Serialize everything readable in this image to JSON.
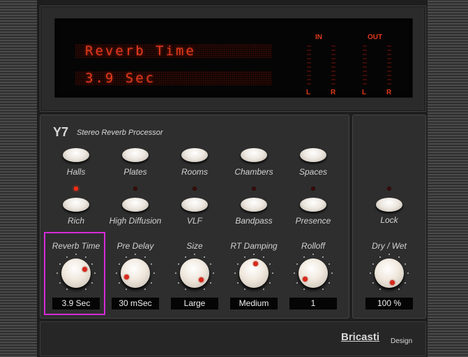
{
  "display": {
    "line1": "Reverb Time",
    "line2": "3.9 Sec",
    "in_label": "IN",
    "out_label": "OUT",
    "channels": [
      "L",
      "R",
      "L",
      "R"
    ]
  },
  "header": {
    "model": "Y7",
    "subtitle": "Stereo Reverb Processor"
  },
  "algorithms": [
    {
      "label": "Halls",
      "led": true
    },
    {
      "label": "Plates",
      "led": false
    },
    {
      "label": "Rooms",
      "led": false
    },
    {
      "label": "Chambers",
      "led": false
    },
    {
      "label": "Spaces",
      "led": false
    }
  ],
  "modifiers": [
    {
      "label": "Rich"
    },
    {
      "label": "High Diffusion"
    },
    {
      "label": "VLF"
    },
    {
      "label": "Bandpass"
    },
    {
      "label": "Presence"
    }
  ],
  "lock": {
    "label": "Lock",
    "led": false
  },
  "knobs": [
    {
      "label": "Reverb Time",
      "value": "3.9 Sec",
      "angle": 68,
      "selected": true
    },
    {
      "label": "Pre Delay",
      "value": "30 mSec",
      "angle": -115
    },
    {
      "label": "Size",
      "value": "Large",
      "angle": 135
    },
    {
      "label": "RT Damping",
      "value": "Medium",
      "angle": 10
    },
    {
      "label": "Rolloff",
      "value": "1",
      "angle": -125
    },
    {
      "label": "Dry / Wet",
      "value": "100 %",
      "angle": 160
    }
  ],
  "brand": {
    "name": "Bricasti",
    "suffix": "Design"
  },
  "colors": {
    "lcd": "#e03a1c",
    "led_on": "#ff2a12",
    "selection": "#d62ad8"
  }
}
